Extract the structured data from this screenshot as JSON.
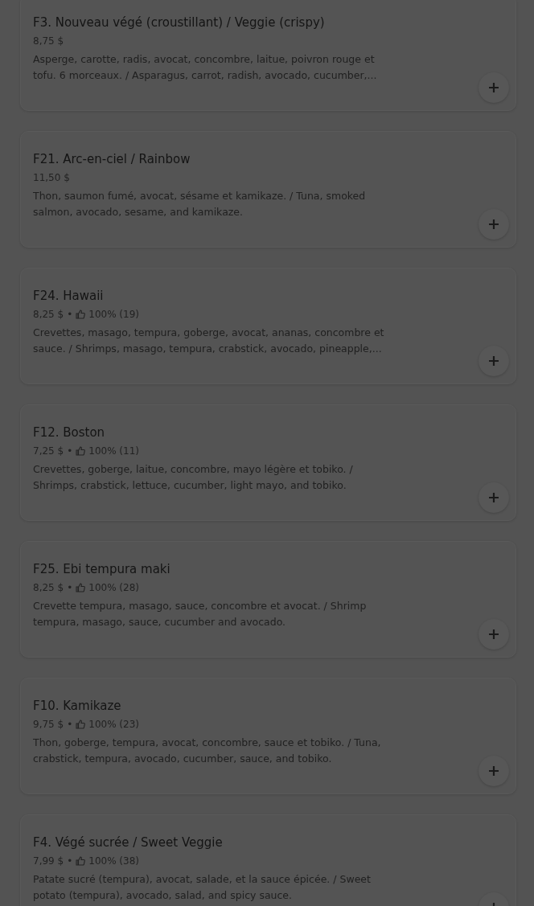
{
  "items": [
    {
      "name": "F3. Nouveau végé (croustillant) / Veggie (crispy)",
      "price": "8,75 $",
      "description": "Asperge, carotte, radis, avocat, concombre, laitue, poivron rouge et tofu. 6 morceaux. / Asparagus, carrot, radish, avocado, cucumber,..."
    },
    {
      "name": "F21. Arc-en-ciel / Rainbow",
      "price": "11,50 $",
      "description": "Thon, saumon fumé, avocat, sésame et kamikaze. / Tuna, smoked salmon, avocado, sesame, and kamikaze."
    },
    {
      "name": "F24. Hawaii",
      "price": "8,25 $",
      "separator": "•",
      "rating": "100% (19)",
      "description": "Crevettes, masago, tempura, goberge, avocat, ananas, concombre et sauce. / Shrimps, masago, tempura, crabstick, avocado, pineapple,..."
    },
    {
      "name": "F12. Boston",
      "price": "7,25 $",
      "separator": "•",
      "rating": "100% (11)",
      "description": "Crevettes, goberge, laitue, concombre, mayo légère et tobiko. / Shrimps, crabstick, lettuce, cucumber, light mayo, and tobiko."
    },
    {
      "name": "F25. Ebi tempura maki",
      "price": "8,25 $",
      "separator": "•",
      "rating": "100% (28)",
      "description": "Crevette tempura, masago, sauce, concombre et avocat. / Shrimp tempura, masago, sauce, cucumber and avocado."
    },
    {
      "name": "F10. Kamikaze",
      "price": "9,75 $",
      "separator": "•",
      "rating": "100% (23)",
      "description": "Thon, goberge, tempura, avocat, concombre, sauce et tobiko. / Tuna, crabstick, tempura, avocado, cucumber, sauce, and tobiko."
    },
    {
      "name": "F4. Végé sucrée / Sweet Veggie",
      "price": "7,99 $",
      "separator": "•",
      "rating": "100% (38)",
      "description": "Patate sucré (tempura), avocat, salade, et la sauce épicée. / Sweet potato (tempura), avocado, salad, and spicy sauce."
    }
  ]
}
